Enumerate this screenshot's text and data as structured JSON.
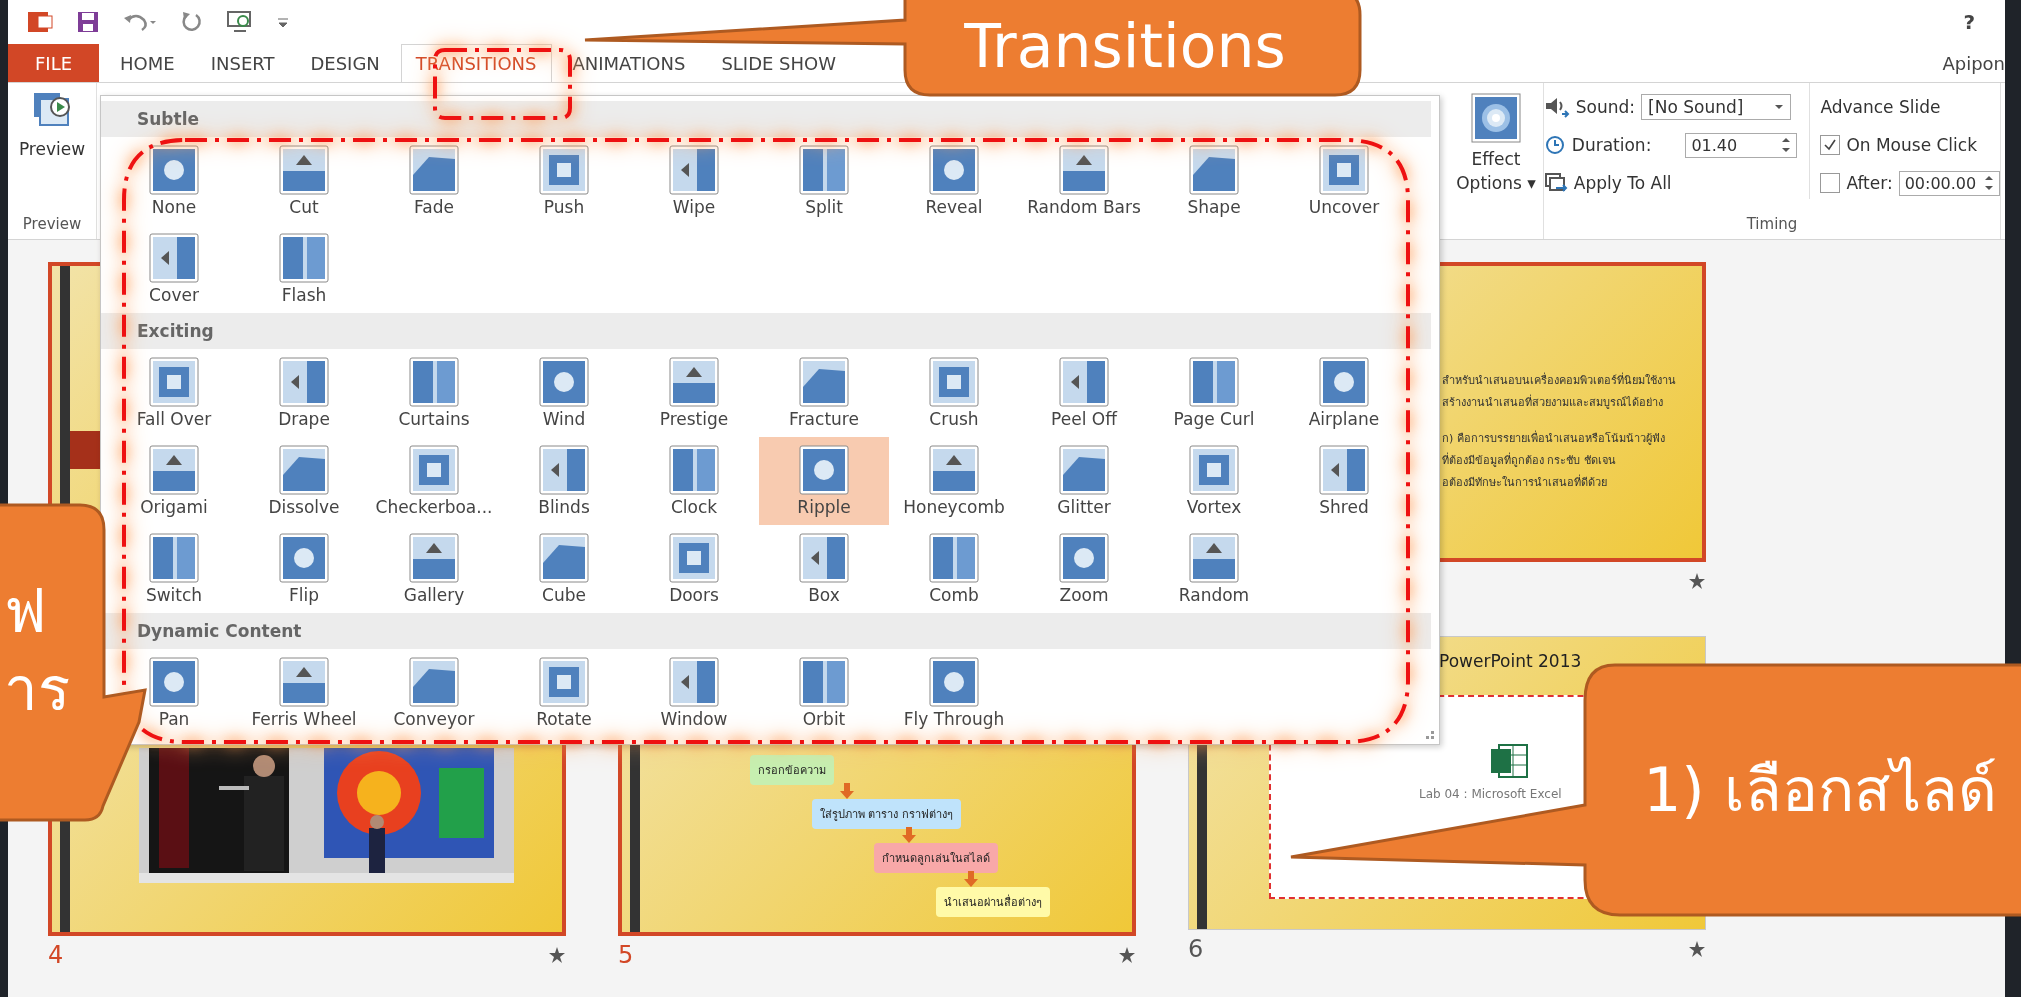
{
  "title_bar": {
    "help": "?",
    "user": "Apipon"
  },
  "tabs": [
    {
      "label": "FILE",
      "kind": "file",
      "selected": false
    },
    {
      "label": "HOME",
      "kind": "tab",
      "selected": false
    },
    {
      "label": "INSERT",
      "kind": "tab",
      "selected": false
    },
    {
      "label": "DESIGN",
      "kind": "tab",
      "selected": false
    },
    {
      "label": "TRANSITIONS",
      "kind": "tab",
      "selected": true
    },
    {
      "label": "ANIMATIONS",
      "kind": "tab",
      "selected": false
    },
    {
      "label": "SLIDE SHOW",
      "kind": "tab",
      "selected": false
    }
  ],
  "preview_group": {
    "button": "Preview",
    "label": "Preview"
  },
  "gallery": {
    "sections": [
      {
        "title": "Subtle",
        "items": [
          {
            "label": "None",
            "selected": false
          },
          {
            "label": "Cut",
            "selected": false
          },
          {
            "label": "Fade",
            "selected": false
          },
          {
            "label": "Push",
            "selected": false
          },
          {
            "label": "Wipe",
            "selected": false
          },
          {
            "label": "Split",
            "selected": false
          },
          {
            "label": "Reveal",
            "selected": false
          },
          {
            "label": "Random Bars",
            "selected": false
          },
          {
            "label": "Shape",
            "selected": false
          },
          {
            "label": "Uncover",
            "selected": false
          },
          {
            "label": "Cover",
            "selected": false
          },
          {
            "label": "Flash",
            "selected": false
          }
        ]
      },
      {
        "title": "Exciting",
        "items": [
          {
            "label": "Fall Over",
            "selected": false
          },
          {
            "label": "Drape",
            "selected": false
          },
          {
            "label": "Curtains",
            "selected": false
          },
          {
            "label": "Wind",
            "selected": false
          },
          {
            "label": "Prestige",
            "selected": false
          },
          {
            "label": "Fracture",
            "selected": false
          },
          {
            "label": "Crush",
            "selected": false
          },
          {
            "label": "Peel Off",
            "selected": false
          },
          {
            "label": "Page Curl",
            "selected": false
          },
          {
            "label": "Airplane",
            "selected": false
          },
          {
            "label": "Origami",
            "selected": false
          },
          {
            "label": "Dissolve",
            "selected": false
          },
          {
            "label": "Checkerboa...",
            "selected": false
          },
          {
            "label": "Blinds",
            "selected": false
          },
          {
            "label": "Clock",
            "selected": false
          },
          {
            "label": "Ripple",
            "selected": true
          },
          {
            "label": "Honeycomb",
            "selected": false
          },
          {
            "label": "Glitter",
            "selected": false
          },
          {
            "label": "Vortex",
            "selected": false
          },
          {
            "label": "Shred",
            "selected": false
          },
          {
            "label": "Switch",
            "selected": false
          },
          {
            "label": "Flip",
            "selected": false
          },
          {
            "label": "Gallery",
            "selected": false
          },
          {
            "label": "Cube",
            "selected": false
          },
          {
            "label": "Doors",
            "selected": false
          },
          {
            "label": "Box",
            "selected": false
          },
          {
            "label": "Comb",
            "selected": false
          },
          {
            "label": "Zoom",
            "selected": false
          },
          {
            "label": "Random",
            "selected": false
          }
        ]
      },
      {
        "title": "Dynamic Content",
        "items": [
          {
            "label": "Pan",
            "selected": false
          },
          {
            "label": "Ferris Wheel",
            "selected": false
          },
          {
            "label": "Conveyor",
            "selected": false
          },
          {
            "label": "Rotate",
            "selected": false
          },
          {
            "label": "Window",
            "selected": false
          },
          {
            "label": "Orbit",
            "selected": false
          },
          {
            "label": "Fly Through",
            "selected": false
          }
        ]
      }
    ]
  },
  "effect_options": {
    "label": "Effect Options ▾"
  },
  "timing": {
    "sound_label": "Sound:",
    "sound_value": "[No Sound]",
    "duration_label": "Duration:",
    "duration_value": "01.40",
    "apply_all": "Apply To All",
    "advance_title": "Advance Slide",
    "on_click": {
      "label": "On Mouse Click",
      "checked": true
    },
    "after": {
      "label": "After:",
      "checked": false,
      "value": "00:00.00"
    },
    "group_label": "Timing"
  },
  "slides_top": [
    {
      "kind": "band",
      "selected": true
    },
    {
      "kind": "text",
      "selected": true,
      "has_animation": true,
      "lines": [
        "สำหรับนำเสนอบนเครื่องคอมพิวเตอร์ที่นิยมใช้งาน",
        "สร้างงานนำเสนอที่สวยงามและสมบูรณ์ได้อย่าง",
        "ก) คือการบรรยายเพื่อนำเสนอหรือโน้มน้าวผู้ฟัง",
        "ที่ต้องมีข้อมูลที่ถูกต้อง กระชับ ชัดเจน",
        "อต้องมีทักษะในการนำเสนอที่ดีด้วย"
      ]
    }
  ],
  "slides_bottom": [
    {
      "selected": true,
      "number": "4"
    },
    {
      "kind": "flow",
      "selected": true,
      "number": "5",
      "boxes": [
        {
          "text": "กรอกข้อความ",
          "color": "#c6efb0"
        },
        {
          "text": "ใส่รูปภาพ ตาราง กราฟต่างๆ",
          "color": "#bfe3fb"
        },
        {
          "text": "กำหนดลูกเล่นในสไลด์",
          "color": "#f8a8a8"
        },
        {
          "text": "นำเสนอผ่านสื่อต่างๆ",
          "color": "#fffaa8"
        }
      ]
    },
    {
      "kind": "screenshot",
      "selected": false,
      "number": "6",
      "title": "PowerPoint 2013",
      "caption": "Lab 04 : Microsoft Excel"
    }
  ],
  "callouts": [
    {
      "kind": "top",
      "lines": [
        "Transitions"
      ]
    },
    {
      "kind": "left",
      "lines": [
        "ฟ",
        "าร"
      ]
    },
    {
      "kind": "right",
      "lines": [
        "1) เลือกสไลด์"
      ]
    }
  ]
}
